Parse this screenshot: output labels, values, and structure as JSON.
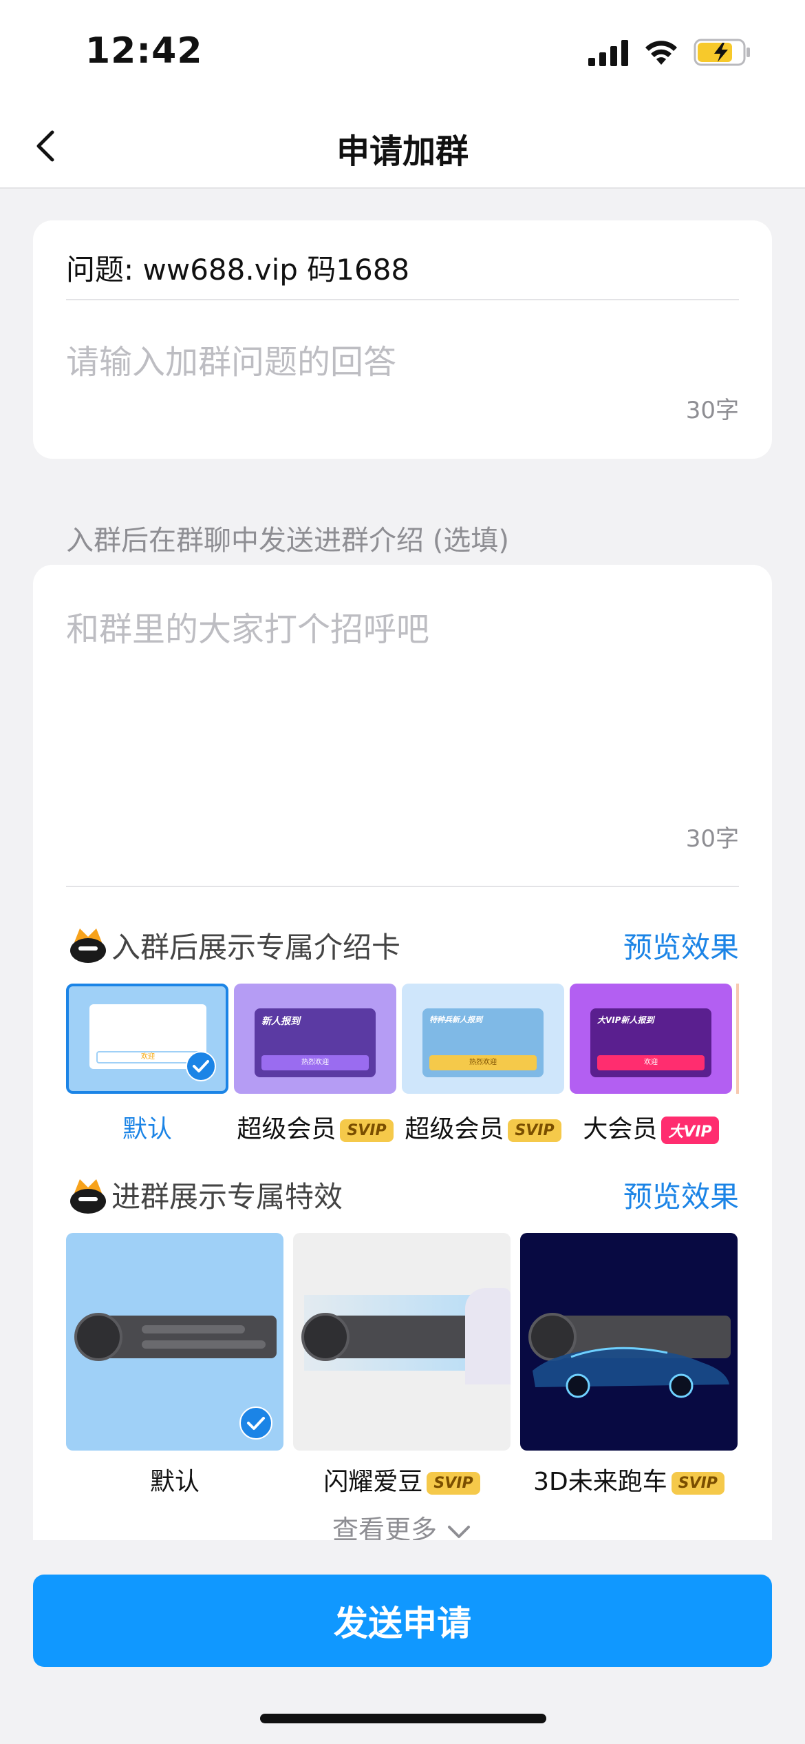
{
  "status_bar": {
    "time": "12:42"
  },
  "nav": {
    "title": "申请加群"
  },
  "question_card": {
    "question": "问题: ww688.vip 码1688",
    "answer_placeholder": "请输入加群问题的回答",
    "char_limit": "30字"
  },
  "intro_section": {
    "label": "入群后在群聊中发送进群介绍 (选填)",
    "placeholder": "和群里的大家打个招呼吧",
    "char_limit": "30字"
  },
  "intro_card_section": {
    "title": "入群后展示专属介绍卡",
    "preview_label": "预览效果",
    "options": [
      {
        "label": "默认",
        "selected": true,
        "badge": ""
      },
      {
        "label": "超级会员",
        "selected": false,
        "badge": "SVIP"
      },
      {
        "label": "超级会员",
        "selected": false,
        "badge": "SVIP"
      },
      {
        "label": "大会员",
        "selected": false,
        "badge": "大VIP"
      }
    ],
    "thumb_texts": {
      "new_member": "新人报到",
      "warm_welcome": "热烈欢迎",
      "special_forces": "特种兵新人报到",
      "vip_new": "大VIP新人报到",
      "welcome": "欢迎"
    }
  },
  "effect_section": {
    "title": "进群展示专属特效",
    "preview_label": "预览效果",
    "options": [
      {
        "label": "默认",
        "selected": true,
        "badge": ""
      },
      {
        "label": "闪耀爱豆",
        "selected": false,
        "badge": "SVIP"
      },
      {
        "label": "3D未来跑车",
        "selected": false,
        "badge": "SVIP"
      }
    ],
    "more_label": "查看更多"
  },
  "send_button": {
    "label": "发送申请"
  },
  "colors": {
    "accent": "#1098ff",
    "link": "#1b84e6",
    "svip_badge": "#f5c94a",
    "vip_badge": "#ff2d6f"
  }
}
